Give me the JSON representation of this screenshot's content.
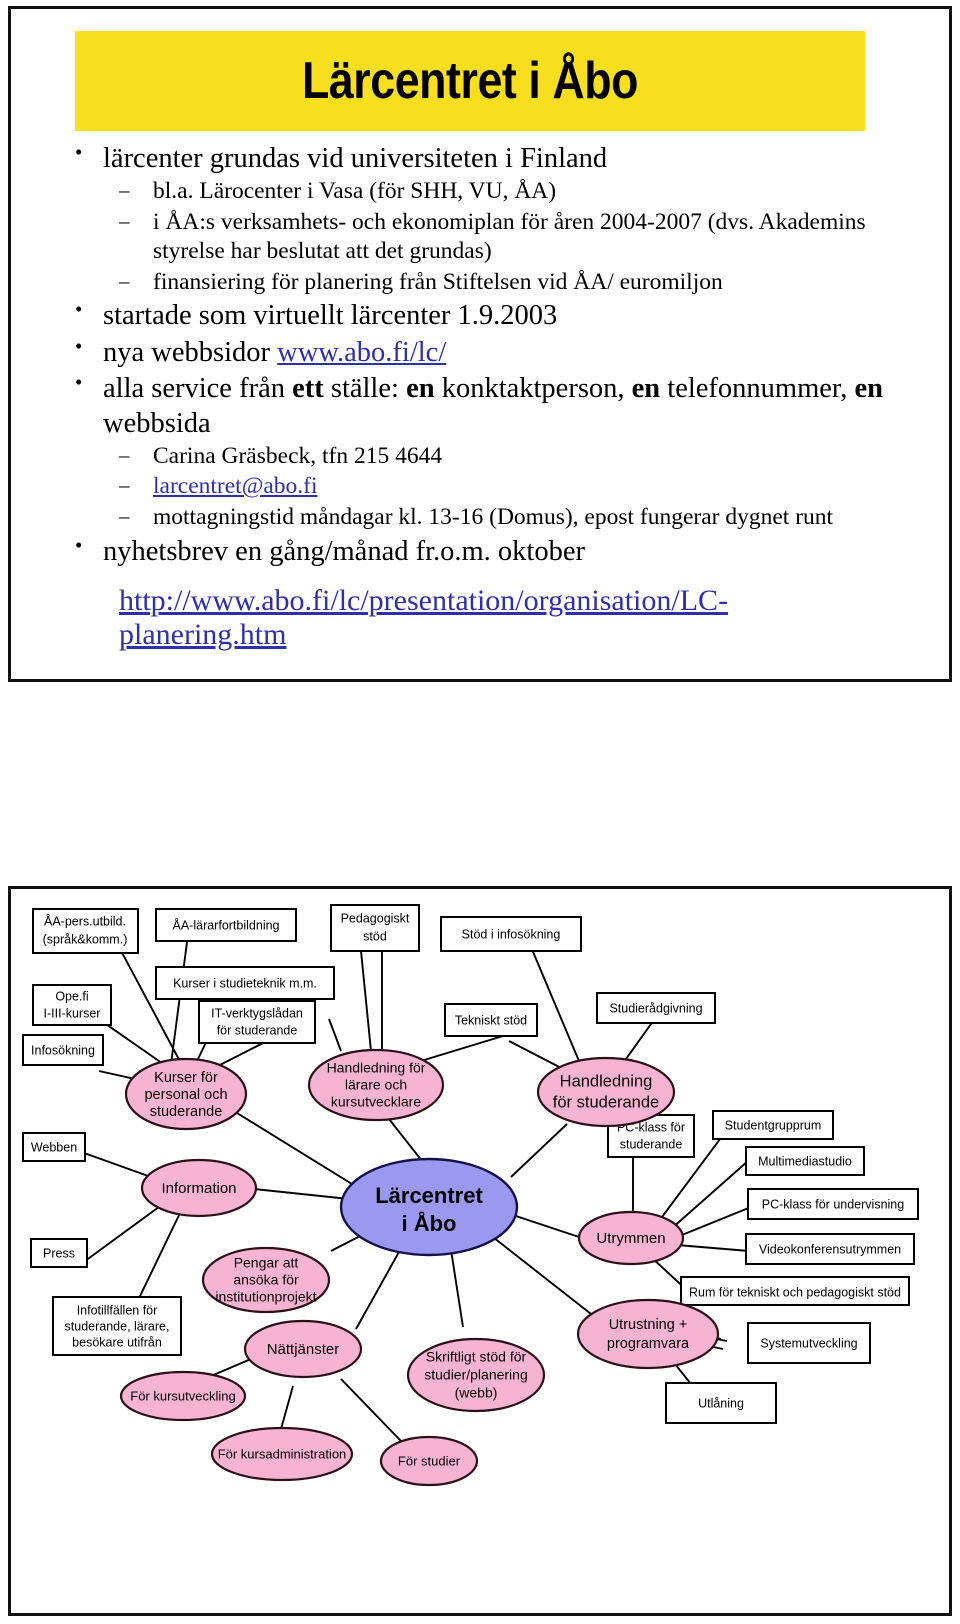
{
  "slide1": {
    "title": "Lärcentret i Åbo",
    "bullets": [
      {
        "level": 1,
        "text": "lärcenter grundas vid universiteten i Finland"
      },
      {
        "level": 2,
        "text": "bl.a. Lärocenter i Vasa (för SHH, VU, ÅA)"
      },
      {
        "level": 2,
        "text": "i ÅA:s verksamhets- och ekonomiplan för åren 2004-2007 (dvs. Akademins styrelse har beslutat att det grundas)"
      },
      {
        "level": 2,
        "text": "finansiering för planering från Stiftelsen vid ÅA/ euromiljon"
      },
      {
        "level": 1,
        "text": "startade som virtuellt lärcenter 1.9.2003"
      },
      {
        "level": 1,
        "text_prefix": "nya webbsidor ",
        "link": "www.abo.fi/lc/"
      },
      {
        "level": 1,
        "rich": "alla service från ett ställe: en konktaktperson, en telefonnummer, en webbsida"
      },
      {
        "level": 2,
        "text": "Carina Gräsbeck, tfn 215 4644"
      },
      {
        "level": 2,
        "link": "larcentret@abo.fi"
      },
      {
        "level": 2,
        "text": "mottagningstid måndagar kl. 13-16 (Domus), epost fungerar dygnet runt"
      },
      {
        "level": 1,
        "text": "nyhetsbrev en gång/månad fr.o.m. oktober"
      }
    ],
    "bullet_rich_parts": {
      "p1": "alla service från ",
      "b1": "ett",
      "p2": " ställe: ",
      "b2": "en",
      "p3": " konktaktperson, ",
      "b3": "en",
      "p4": " telefonnummer, ",
      "b4": "en",
      "p5": " webbsida"
    },
    "big_url": "http://www.abo.fi/lc/presentation/organisation/LC-planering.htm"
  },
  "slide2": {
    "center_label_line1": "Lärcentret",
    "center_label_line2": "i Åbo",
    "nodes": [
      {
        "id": "aa-pers-utbild",
        "shape": "rect",
        "lines": [
          "ÅA-pers.utbild.",
          "(språk&komm.)"
        ]
      },
      {
        "id": "aa-lararfortbildning",
        "shape": "rect",
        "lines": [
          "ÅA-lärarfortbildning"
        ]
      },
      {
        "id": "pedagogiskt-stod",
        "shape": "rect",
        "lines": [
          "Pedagogiskt",
          "stöd"
        ]
      },
      {
        "id": "stod-i-infosokning",
        "shape": "rect",
        "lines": [
          "Stöd i infosökning"
        ]
      },
      {
        "id": "ope-fi",
        "shape": "rect",
        "lines": [
          "Ope.fi",
          "I-III-kurser"
        ]
      },
      {
        "id": "kurser-i-studieteknik",
        "shape": "rect",
        "lines": [
          "Kurser i studieteknik m.m."
        ]
      },
      {
        "id": "it-verktygsladan",
        "shape": "rect",
        "lines": [
          "IT-verktygslådan",
          "för studerande"
        ]
      },
      {
        "id": "tekniskt-stod",
        "shape": "rect",
        "lines": [
          "Tekniskt stöd"
        ]
      },
      {
        "id": "studieradgivning",
        "shape": "rect",
        "lines": [
          "Studierådgivning"
        ]
      },
      {
        "id": "infosokning",
        "shape": "rect",
        "lines": [
          "Infosökning"
        ]
      },
      {
        "id": "webben",
        "shape": "rect",
        "lines": [
          "Webben"
        ]
      },
      {
        "id": "studentgrupprum",
        "shape": "rect",
        "lines": [
          "Studentgrupprum"
        ]
      },
      {
        "id": "multimediastudio",
        "shape": "rect",
        "lines": [
          "Multimediastudio"
        ]
      },
      {
        "id": "pc-klass-studerande",
        "shape": "rect",
        "lines": [
          "PC-klass för",
          "studerande"
        ]
      },
      {
        "id": "pc-klass-undervisning",
        "shape": "rect",
        "lines": [
          "PC-klass för undervisning"
        ]
      },
      {
        "id": "videokonferensutrymmen",
        "shape": "rect",
        "lines": [
          "Videokonferensutrymmen"
        ]
      },
      {
        "id": "press",
        "shape": "rect",
        "lines": [
          "Press"
        ]
      },
      {
        "id": "rum-for-tekniskt",
        "shape": "rect",
        "lines": [
          "Rum för tekniskt och pedagogiskt stöd"
        ]
      },
      {
        "id": "infotillfallen",
        "shape": "rect",
        "lines": [
          "Infotillfällen för",
          "studerande, lärare,",
          "besökare utifrån"
        ]
      },
      {
        "id": "systemutveckling",
        "shape": "rect",
        "lines": [
          "Systemutveckling"
        ]
      },
      {
        "id": "utlaning",
        "shape": "rect",
        "lines": [
          "Utlåning"
        ]
      },
      {
        "id": "kurser-for-personal",
        "shape": "ellipse",
        "lines": [
          "Kurser för",
          "personal och",
          "studerande"
        ]
      },
      {
        "id": "handledning-larare",
        "shape": "ellipse",
        "lines": [
          "Handledning för",
          "lärare och",
          "kursutvecklare"
        ]
      },
      {
        "id": "handledning-studerande",
        "shape": "ellipse",
        "lines": [
          "Handledning",
          "för studerande"
        ]
      },
      {
        "id": "information",
        "shape": "ellipse",
        "lines": [
          "Information"
        ]
      },
      {
        "id": "utrymmen",
        "shape": "ellipse",
        "lines": [
          "Utrymmen"
        ]
      },
      {
        "id": "pengar-att-ansoka",
        "shape": "ellipse",
        "lines": [
          "Pengar att",
          "ansöka för",
          "institutionprojekt"
        ]
      },
      {
        "id": "utrustning-programvara",
        "shape": "ellipse",
        "lines": [
          "Utrustning +",
          "programvara"
        ]
      },
      {
        "id": "nattjanster",
        "shape": "ellipse",
        "lines": [
          "Nättjänster"
        ]
      },
      {
        "id": "skriftligt-stod",
        "shape": "ellipse",
        "lines": [
          "Skriftligt stöd för",
          "studier/planering",
          "(webb)"
        ]
      },
      {
        "id": "for-kursutveckling",
        "shape": "ellipse",
        "lines": [
          "För kursutveckling"
        ]
      },
      {
        "id": "for-kursadministration",
        "shape": "ellipse",
        "lines": [
          "För kursadministration"
        ]
      },
      {
        "id": "for-studier",
        "shape": "ellipse",
        "lines": [
          "För studier"
        ]
      },
      {
        "id": "larcentret-center",
        "shape": "ellipse-center",
        "lines": [
          "Lärcentret",
          "i Åbo"
        ]
      }
    ]
  },
  "colors": {
    "title_banner": "#f7de1e",
    "pink_node": "#f7b4d2",
    "purple_node": "#9a98ef",
    "link": "#2f2fa8",
    "outline": "#000000"
  }
}
